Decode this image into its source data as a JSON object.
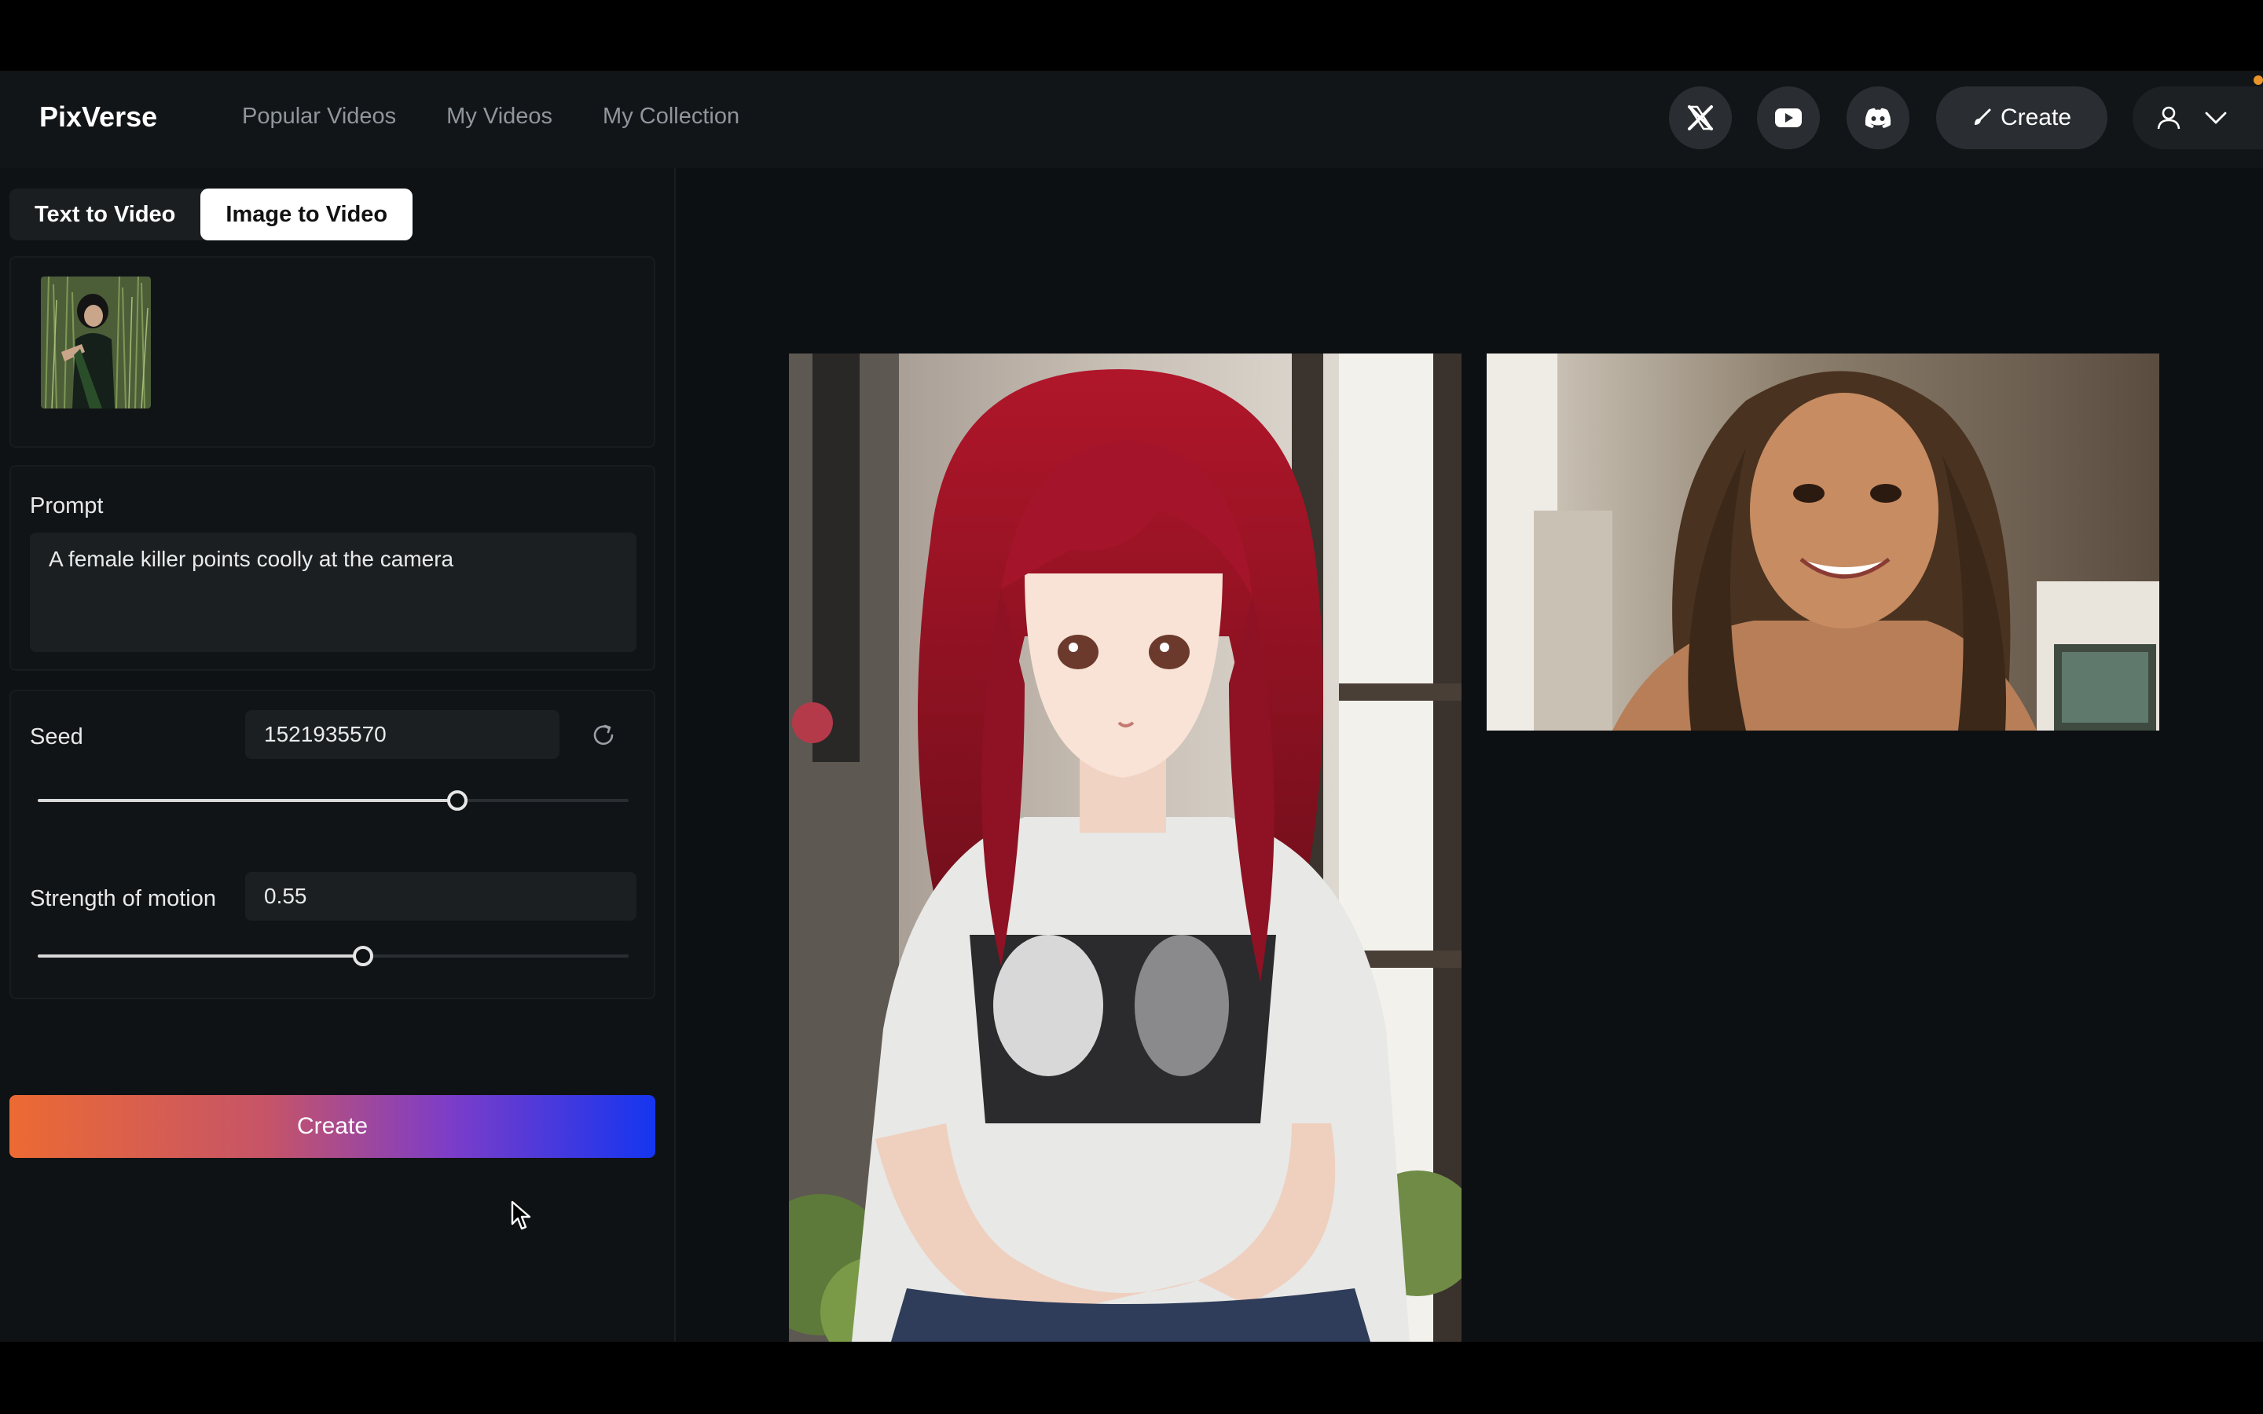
{
  "header": {
    "logo": "PixVerse",
    "nav": [
      "Popular Videos",
      "My Videos",
      "My Collection"
    ],
    "social": [
      "x-icon",
      "youtube-icon",
      "discord-icon"
    ],
    "create_label": "Create"
  },
  "tabs": [
    "Text to Video",
    "Image to Video"
  ],
  "active_tab": "Image to Video",
  "prompt": {
    "label": "Prompt",
    "value": "A female killer points coolly at the camera"
  },
  "seed": {
    "label": "Seed",
    "value": "1521935570",
    "slider_fraction": 0.71
  },
  "motion": {
    "label": "Strength of motion",
    "value": "0.55",
    "slider_fraction": 0.55
  },
  "create_button": "Create",
  "colors": {
    "gradient_start": "#ec6a33",
    "gradient_end": "#1535f0",
    "notification": "#e8942a"
  }
}
